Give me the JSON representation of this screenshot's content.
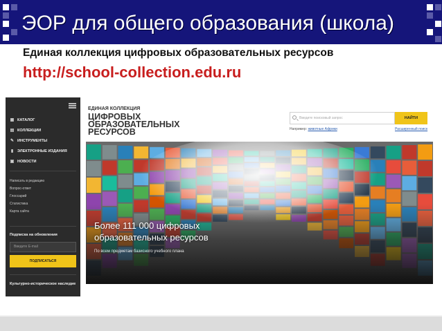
{
  "slide": {
    "title": "ЭОР для общего образования (школа)",
    "subtitle": "Единая коллекция цифровых образовательных ресурсов",
    "url": "http://school-collection.edu.ru"
  },
  "sidebar": {
    "nav": [
      {
        "label": "КАТАЛОГ",
        "icon": "catalog-icon"
      },
      {
        "label": "КОЛЛЕКЦИИ",
        "icon": "collections-icon"
      },
      {
        "label": "ИНСТРУМЕНТЫ",
        "icon": "tools-icon"
      },
      {
        "label": "ЭЛЕКТРОННЫЕ ИЗДАНИЯ",
        "icon": "ebooks-icon"
      },
      {
        "label": "НОВОСТИ",
        "icon": "news-icon"
      }
    ],
    "links": [
      "Написать в редакцию",
      "Вопрос-ответ",
      "Глоссарий",
      "Статистика",
      "Карта сайта"
    ],
    "subscribe": {
      "title": "Подписка на обновления",
      "placeholder": "Введите E-mail",
      "button": "ПОДПИСАТЬСЯ"
    },
    "culture": "Культурно-историческое наследие"
  },
  "site": {
    "logo_small": "ЕДИНАЯ КОЛЛЕКЦИЯ",
    "logo_big": [
      "ЦИФРОВЫХ",
      "ОБРАЗОВАТЕЛЬНЫХ",
      "РЕСУРСОВ"
    ],
    "search": {
      "placeholder": "Введите поисковый запрос",
      "button": "НАЙТИ",
      "example_prefix": "Например:",
      "example_link": "животные Африки",
      "advanced": "Расширенный поиск"
    },
    "hero": {
      "line1": "Более 111 000 цифровых",
      "line2": "образовательных ресурсов",
      "sub": "По всем предметам базисного учебного плана"
    }
  },
  "colors": {
    "title_bar": "#15157a",
    "url": "#c81e1e",
    "sidebar_bg": "#2b2b2b",
    "accent_yellow": "#f0c419"
  }
}
